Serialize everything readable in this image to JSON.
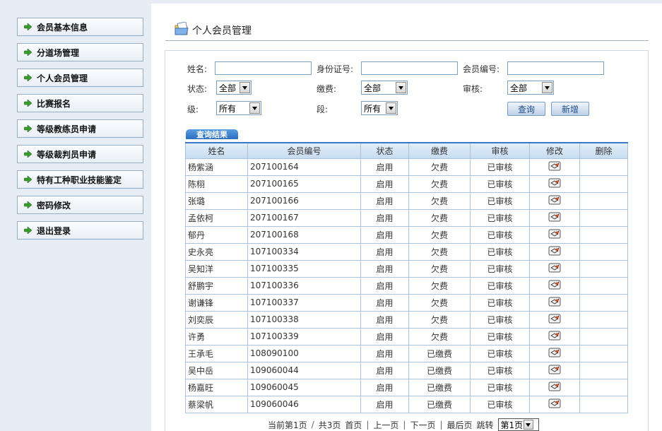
{
  "sidebar": {
    "items": [
      {
        "label": "会员基本信息"
      },
      {
        "label": "分道场管理"
      },
      {
        "label": "个人会员管理"
      },
      {
        "label": "比赛报名"
      },
      {
        "label": "等级教练员申请"
      },
      {
        "label": "等级裁判员申请"
      },
      {
        "label": "特有工种职业技能鉴定"
      },
      {
        "label": "密码修改"
      },
      {
        "label": "退出登录"
      }
    ]
  },
  "header": {
    "title": "个人会员管理"
  },
  "search": {
    "name_label": "姓名:",
    "idcard_label": "身份证号:",
    "member_no_label": "会员编号:",
    "status_label": "状态:",
    "status_value": "全部",
    "fee_label": "缴费:",
    "fee_value": "全部",
    "review_label": "审核:",
    "review_value": "全部",
    "grade_label": "级:",
    "grade_value": "所有",
    "dan_label": "段:",
    "dan_value": "所有",
    "query_button": "查询",
    "add_button": "新增"
  },
  "results": {
    "tab_label": "查询结果",
    "columns": [
      "姓名",
      "会员编号",
      "状态",
      "缴费",
      "审核",
      "修改",
      "删除"
    ],
    "rows": [
      {
        "name": "杨紫涵",
        "no": "207100164",
        "status": "启用",
        "fee": "欠费",
        "review": "已审核"
      },
      {
        "name": "陈栩",
        "no": "207100165",
        "status": "启用",
        "fee": "欠费",
        "review": "已审核"
      },
      {
        "name": "张璐",
        "no": "207100166",
        "status": "启用",
        "fee": "欠费",
        "review": "已审核"
      },
      {
        "name": "孟依柯",
        "no": "207100167",
        "status": "启用",
        "fee": "欠费",
        "review": "已审核"
      },
      {
        "name": "郁丹",
        "no": "207100168",
        "status": "启用",
        "fee": "欠费",
        "review": "已审核"
      },
      {
        "name": "史永亮",
        "no": "107100334",
        "status": "启用",
        "fee": "欠费",
        "review": "已审核"
      },
      {
        "name": "吴知洋",
        "no": "107100335",
        "status": "启用",
        "fee": "欠费",
        "review": "已审核"
      },
      {
        "name": "舒鹏宇",
        "no": "107100336",
        "status": "启用",
        "fee": "欠费",
        "review": "已审核"
      },
      {
        "name": "谢谦锋",
        "no": "107100337",
        "status": "启用",
        "fee": "欠费",
        "review": "已审核"
      },
      {
        "name": "刘奕辰",
        "no": "107100338",
        "status": "启用",
        "fee": "欠费",
        "review": "已审核"
      },
      {
        "name": "许勇",
        "no": "107100339",
        "status": "启用",
        "fee": "欠费",
        "review": "已审核"
      },
      {
        "name": "王承毛",
        "no": "108090100",
        "status": "启用",
        "fee": "已缴费",
        "review": "已审核"
      },
      {
        "name": "吴中岳",
        "no": "109060044",
        "status": "启用",
        "fee": "已缴费",
        "review": "已审核"
      },
      {
        "name": "杨嘉旺",
        "no": "109060045",
        "status": "启用",
        "fee": "已缴费",
        "review": "已审核"
      },
      {
        "name": "蔡梁帆",
        "no": "109060046",
        "status": "启用",
        "fee": "已缴费",
        "review": "已审核"
      }
    ]
  },
  "pager": {
    "current": "当前第1页",
    "total": "共3页",
    "first": "首页",
    "prev": "上一页",
    "next": "下一页",
    "last": "最后页",
    "jump_label": "跳转",
    "jump_value": "第1页"
  },
  "colors": {
    "accent": "#3a7ac2",
    "border": "#a8c3df",
    "sidebar_bg": "#e6edf5"
  }
}
